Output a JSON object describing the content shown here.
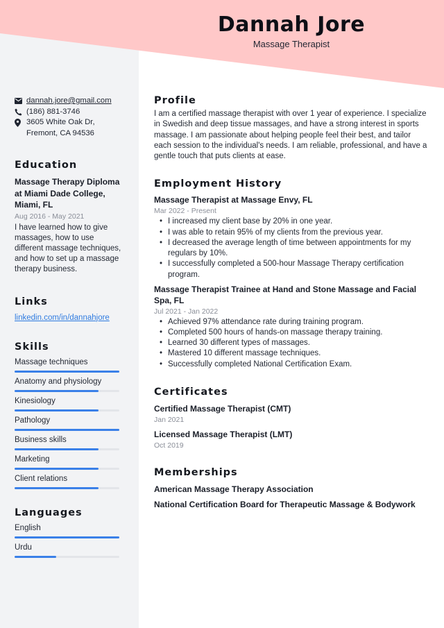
{
  "header": {
    "name": "Dannah Jore",
    "title": "Massage Therapist"
  },
  "colors": {
    "banner": "#ffc8c8",
    "sidebar": "#f2f3f5",
    "accent": "#3a80e8",
    "link": "#2f7be0"
  },
  "contact": {
    "email": "dannah.jore@gmail.com",
    "email_icon": "envelope-icon",
    "phone": "(186) 881-3746",
    "phone_icon": "phone-icon",
    "address": "3605 White Oak Dr, Fremont, CA 94536",
    "address_icon": "map-marker-icon"
  },
  "education": {
    "heading": "Education",
    "items": [
      {
        "title": "Massage Therapy Diploma at Miami Dade College, Miami, FL",
        "date": "Aug 2016 - May 2021",
        "description": "I have learned how to give massages, how to use different massage techniques, and how to set up a massage therapy business."
      }
    ]
  },
  "links": {
    "heading": "Links",
    "items": [
      {
        "label": "linkedin.com/in/dannahjore"
      }
    ]
  },
  "skills": {
    "heading": "Skills",
    "items": [
      {
        "label": "Massage techniques",
        "level": 100
      },
      {
        "label": "Anatomy and physiology",
        "level": 80
      },
      {
        "label": "Kinesiology",
        "level": 80
      },
      {
        "label": "Pathology",
        "level": 100
      },
      {
        "label": "Business skills",
        "level": 80
      },
      {
        "label": "Marketing",
        "level": 80
      },
      {
        "label": "Client relations",
        "level": 80
      }
    ]
  },
  "languages": {
    "heading": "Languages",
    "items": [
      {
        "label": "English",
        "level": 100
      },
      {
        "label": "Urdu",
        "level": 40
      }
    ]
  },
  "profile": {
    "heading": "Profile",
    "text": "I am a certified massage therapist with over 1 year of experience. I specialize in Swedish and deep tissue massages, and have a strong interest in sports massage. I am passionate about helping people feel their best, and tailor each session to the individual's needs. I am reliable, professional, and have a gentle touch that puts clients at ease."
  },
  "employment": {
    "heading": "Employment History",
    "jobs": [
      {
        "title": "Massage Therapist at Massage Envy, FL",
        "date": "Mar 2022 - Present",
        "bullets": [
          "I increased my client base by 20% in one year.",
          "I was able to retain 95% of my clients from the previous year.",
          "I decreased the average length of time between appointments for my regulars by 10%.",
          "I successfully completed a 500-hour Massage Therapy certification program."
        ]
      },
      {
        "title": "Massage Therapist Trainee at Hand and Stone Massage and Facial Spa, FL",
        "date": "Jul 2021 - Jan 2022",
        "bullets": [
          "Achieved 97% attendance rate during training program.",
          "Completed 500 hours of hands-on massage therapy training.",
          "Learned 30 different types of massages.",
          "Mastered 10 different massage techniques.",
          "Successfully completed National Certification Exam."
        ]
      }
    ]
  },
  "certificates": {
    "heading": "Certificates",
    "items": [
      {
        "title": "Certified Massage Therapist (CMT)",
        "date": "Jan 2021"
      },
      {
        "title": "Licensed Massage Therapist (LMT)",
        "date": "Oct 2019"
      }
    ]
  },
  "memberships": {
    "heading": "Memberships",
    "items": [
      "American Massage Therapy Association",
      "National Certification Board for Therapeutic Massage & Bodywork"
    ]
  }
}
